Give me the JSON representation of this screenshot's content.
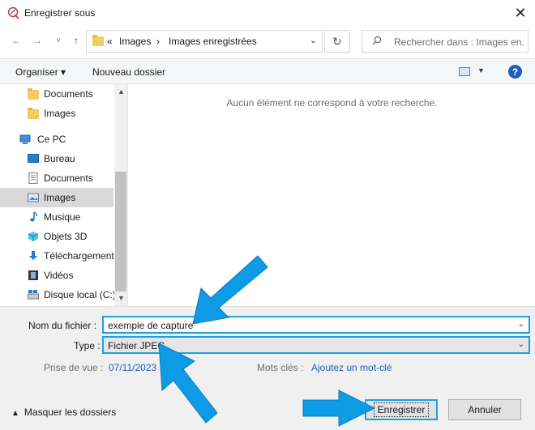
{
  "window": {
    "title": "Enregistrer sous",
    "close_glyph": "✕"
  },
  "nav": {
    "back_icon": "←",
    "forward_icon": "→",
    "recent_icon": "˅",
    "up_icon": "↑",
    "breadcrumb_sep": "«",
    "crumb_1": "Images",
    "crumb_arrow": "›",
    "crumb_2": "Images enregistrées",
    "dropdown_glyph": "⌄",
    "refresh_icon": "↻",
    "search_placeholder": "Rechercher dans : Images en..."
  },
  "toolbar": {
    "organize": "Organiser ▾",
    "new_folder": "Nouveau dossier",
    "view_dd": "▼",
    "help": "?"
  },
  "sidebar": {
    "items": [
      {
        "label": "Documents",
        "icon": "folder-icon"
      },
      {
        "label": "Images",
        "icon": "folder-icon"
      },
      {
        "label": "Ce PC",
        "icon": "computer-icon"
      },
      {
        "label": "Bureau",
        "icon": "desktop-icon"
      },
      {
        "label": "Documents",
        "icon": "document-icon"
      },
      {
        "label": "Images",
        "icon": "pictures-icon",
        "selected": true
      },
      {
        "label": "Musique",
        "icon": "music-icon"
      },
      {
        "label": "Objets 3D",
        "icon": "cube-icon"
      },
      {
        "label": "Téléchargements",
        "icon": "download-icon"
      },
      {
        "label": "Vidéos",
        "icon": "film-icon"
      },
      {
        "label": "Disque local (C:)",
        "icon": "drive-icon"
      }
    ],
    "scroll_up": "▲",
    "scroll_down": "▼"
  },
  "content": {
    "empty_message": "Aucun élément ne correspond à votre recherche."
  },
  "form": {
    "filename_label": "Nom du fichier :",
    "filename_value": "exemple de capture",
    "type_label": "Type :",
    "type_value": "Fichier JPEG",
    "dropdown_glyph": "⌄",
    "date_label": "Prise de vue :",
    "date_value": "07/11/2023 19:2",
    "tags_label": "Mots clés :",
    "tags_value": "Ajoutez un mot-clé",
    "hide_folders": "Masquer les dossiers",
    "hide_chevron": "▲",
    "save": "Enregistrer",
    "cancel": "Annuler"
  },
  "colors": {
    "accent": "#1ba1e2",
    "link": "#1f5fb8",
    "folder": "#f3cd62"
  }
}
